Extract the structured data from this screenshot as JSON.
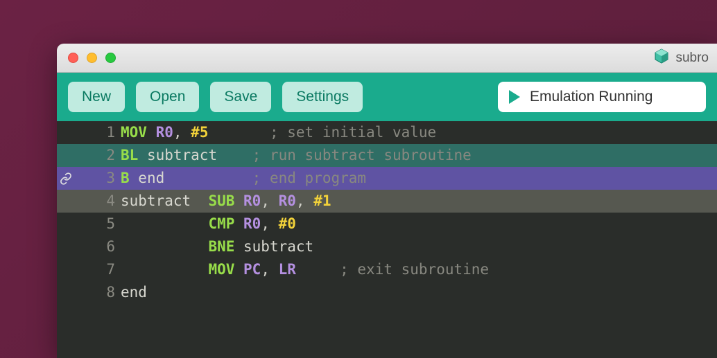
{
  "window": {
    "title": "subro"
  },
  "toolbar": {
    "new_label": "New",
    "open_label": "Open",
    "save_label": "Save",
    "settings_label": "Settings"
  },
  "status": {
    "text": "Emulation Running"
  },
  "editor": {
    "lines": [
      {
        "n": 1,
        "highlight": null,
        "gutter_icon": null,
        "tokens": [
          {
            "t": "MOV ",
            "c": "op"
          },
          {
            "t": "R0",
            "c": "reg"
          },
          {
            "t": ", ",
            "c": "p"
          },
          {
            "t": "#5",
            "c": "num"
          },
          {
            "t": "       ",
            "c": "p"
          },
          {
            "t": "; set initial value",
            "c": "cmt"
          }
        ]
      },
      {
        "n": 2,
        "highlight": "teal",
        "gutter_icon": null,
        "tokens": [
          {
            "t": "BL ",
            "c": "op"
          },
          {
            "t": "subtract",
            "c": "lbl"
          },
          {
            "t": "    ",
            "c": "p"
          },
          {
            "t": "; run subtract subroutine",
            "c": "cmt"
          }
        ]
      },
      {
        "n": 3,
        "highlight": "purple",
        "gutter_icon": "link",
        "tokens": [
          {
            "t": "B ",
            "c": "op"
          },
          {
            "t": "end",
            "c": "lbl"
          },
          {
            "t": "          ",
            "c": "p"
          },
          {
            "t": "; end program",
            "c": "cmt"
          }
        ]
      },
      {
        "n": 4,
        "highlight": "grey",
        "gutter_icon": null,
        "tokens": [
          {
            "t": "subtract  ",
            "c": "lbl"
          },
          {
            "t": "SUB ",
            "c": "op"
          },
          {
            "t": "R0",
            "c": "reg"
          },
          {
            "t": ", ",
            "c": "p"
          },
          {
            "t": "R0",
            "c": "reg"
          },
          {
            "t": ", ",
            "c": "p"
          },
          {
            "t": "#1",
            "c": "num"
          }
        ]
      },
      {
        "n": 5,
        "highlight": null,
        "gutter_icon": null,
        "tokens": [
          {
            "t": "          ",
            "c": "p"
          },
          {
            "t": "CMP ",
            "c": "op"
          },
          {
            "t": "R0",
            "c": "reg"
          },
          {
            "t": ", ",
            "c": "p"
          },
          {
            "t": "#0",
            "c": "num"
          }
        ]
      },
      {
        "n": 6,
        "highlight": null,
        "gutter_icon": null,
        "tokens": [
          {
            "t": "          ",
            "c": "p"
          },
          {
            "t": "BNE ",
            "c": "op"
          },
          {
            "t": "subtract",
            "c": "lbl"
          }
        ]
      },
      {
        "n": 7,
        "highlight": null,
        "gutter_icon": null,
        "tokens": [
          {
            "t": "          ",
            "c": "p"
          },
          {
            "t": "MOV ",
            "c": "op"
          },
          {
            "t": "PC",
            "c": "reg"
          },
          {
            "t": ", ",
            "c": "p"
          },
          {
            "t": "LR",
            "c": "reg"
          },
          {
            "t": "     ",
            "c": "p"
          },
          {
            "t": "; exit subroutine",
            "c": "cmt"
          }
        ]
      },
      {
        "n": 8,
        "highlight": null,
        "gutter_icon": null,
        "tokens": [
          {
            "t": "end",
            "c": "lbl"
          }
        ]
      }
    ]
  }
}
